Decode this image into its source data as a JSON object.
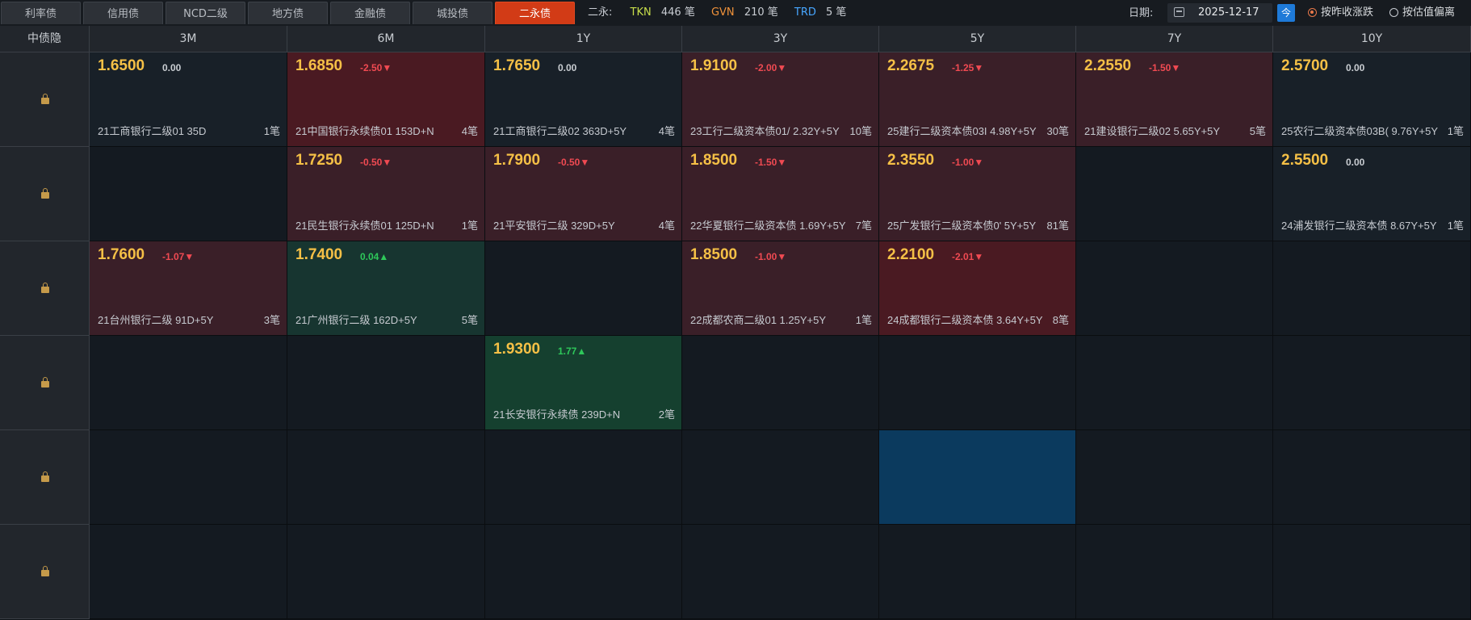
{
  "tabs": [
    "利率债",
    "信用债",
    "NCD二级",
    "地方债",
    "金融债",
    "城投债",
    "二永债"
  ],
  "active_tab": 6,
  "stats": {
    "label": "二永:",
    "tkn_label": "TKN",
    "tkn_value": "446 笔",
    "gvn_label": "GVN",
    "gvn_value": "210 笔",
    "trd_label": "TRD",
    "trd_value": "5 笔"
  },
  "date": {
    "label": "日期:",
    "value": "2025-12-17",
    "today_button": "今"
  },
  "radios": [
    {
      "label": "按昨收涨跌",
      "checked": true
    },
    {
      "label": "按估值偏离",
      "checked": false
    }
  ],
  "grid": {
    "corner": "中债隐",
    "columns": [
      "3M",
      "6M",
      "1Y",
      "3Y",
      "5Y",
      "7Y",
      "10Y"
    ],
    "rows": [
      [
        {
          "yield": "1.6500",
          "change": "0.00",
          "dir": "zero",
          "bond": "21工商银行二级01 35D",
          "count": "1笔",
          "tone": "neutral"
        },
        {
          "yield": "1.6850",
          "change": "-2.50▼",
          "dir": "neg",
          "bond": "21中国银行永续债01 153D+N",
          "count": "4笔",
          "tone": "down-strong"
        },
        {
          "yield": "1.7650",
          "change": "0.00",
          "dir": "zero",
          "bond": "21工商银行二级02 363D+5Y",
          "count": "4笔",
          "tone": "neutral"
        },
        {
          "yield": "1.9100",
          "change": "-2.00▼",
          "dir": "neg",
          "bond": "23工行二级资本债01/ 2.32Y+5Y",
          "count": "10笔",
          "tone": "down"
        },
        {
          "yield": "2.2675",
          "change": "-1.25▼",
          "dir": "neg",
          "bond": "25建行二级资本债03I 4.98Y+5Y",
          "count": "30笔",
          "tone": "down"
        },
        {
          "yield": "2.2550",
          "change": "-1.50▼",
          "dir": "neg",
          "bond": "21建设银行二级02 5.65Y+5Y",
          "count": "5笔",
          "tone": "down"
        },
        {
          "yield": "2.5700",
          "change": "0.00",
          "dir": "zero",
          "bond": "25农行二级资本债03B( 9.76Y+5Y",
          "count": "1笔",
          "tone": "neutral"
        }
      ],
      [
        null,
        {
          "yield": "1.7250",
          "change": "-0.50▼",
          "dir": "neg",
          "bond": "21民生银行永续债01 125D+N",
          "count": "1笔",
          "tone": "down"
        },
        {
          "yield": "1.7900",
          "change": "-0.50▼",
          "dir": "neg",
          "bond": "21平安银行二级 329D+5Y",
          "count": "4笔",
          "tone": "down"
        },
        {
          "yield": "1.8500",
          "change": "-1.50▼",
          "dir": "neg",
          "bond": "22华夏银行二级资本债 1.69Y+5Y",
          "count": "7笔",
          "tone": "down"
        },
        {
          "yield": "2.3550",
          "change": "-1.00▼",
          "dir": "neg",
          "bond": "25广发银行二级资本债0' 5Y+5Y",
          "count": "81笔",
          "tone": "down"
        },
        null,
        {
          "yield": "2.5500",
          "change": "0.00",
          "dir": "zero",
          "bond": "24浦发银行二级资本债 8.67Y+5Y",
          "count": "1笔",
          "tone": "neutral"
        }
      ],
      [
        {
          "yield": "1.7600",
          "change": "-1.07▼",
          "dir": "neg",
          "bond": "21台州银行二级 91D+5Y",
          "count": "3笔",
          "tone": "down"
        },
        {
          "yield": "1.7400",
          "change": "0.04▲",
          "dir": "pos",
          "bond": "21广州银行二级 162D+5Y",
          "count": "5笔",
          "tone": "up"
        },
        null,
        {
          "yield": "1.8500",
          "change": "-1.00▼",
          "dir": "neg",
          "bond": "22成都农商二级01 1.25Y+5Y",
          "count": "1笔",
          "tone": "down"
        },
        {
          "yield": "2.2100",
          "change": "-2.01▼",
          "dir": "neg",
          "bond": "24成都银行二级资本债 3.64Y+5Y",
          "count": "8笔",
          "tone": "down-strong"
        },
        null,
        null
      ],
      [
        null,
        null,
        {
          "yield": "1.9300",
          "change": "1.77▲",
          "dir": "pos",
          "bond": "21长安银行永续债 239D+N",
          "count": "2笔",
          "tone": "up-strong"
        },
        null,
        null,
        null,
        null
      ],
      [
        null,
        null,
        null,
        null,
        {
          "selected": true
        },
        null,
        null
      ],
      [
        null,
        null,
        null,
        null,
        null,
        null,
        null
      ]
    ]
  }
}
